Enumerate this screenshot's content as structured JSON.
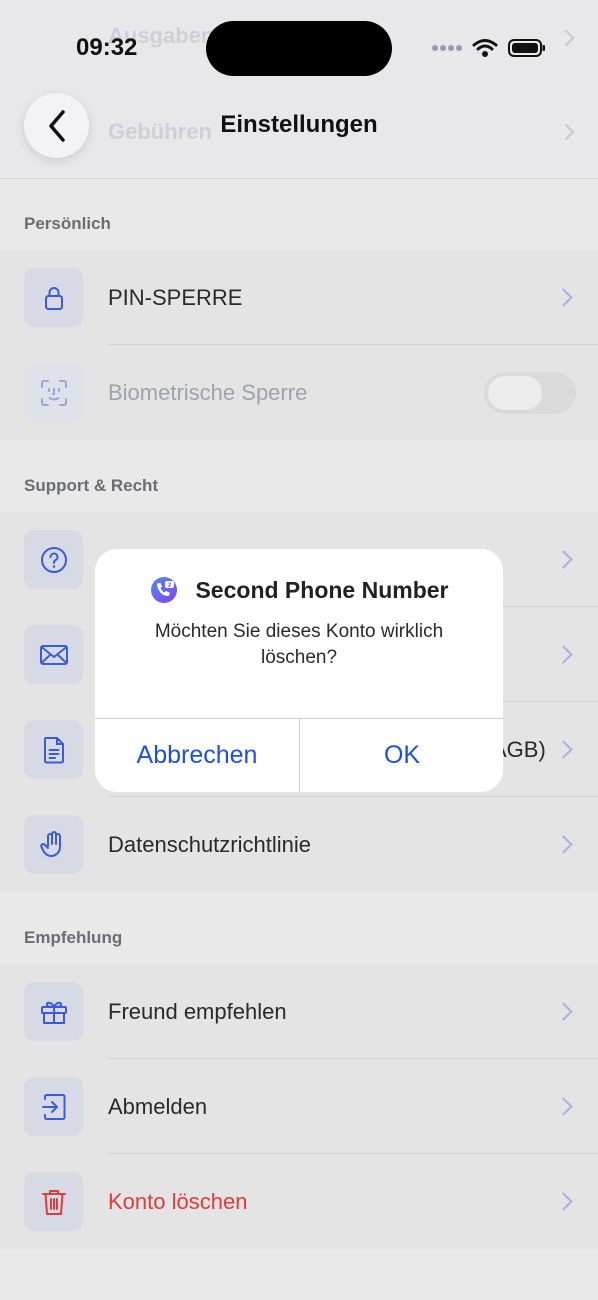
{
  "status_bar": {
    "time": "09:32"
  },
  "header": {
    "title": "Einstellungen",
    "back_icon": "chevron-left-icon",
    "background_ghost": [
      "Ausgaben",
      "Gebühren"
    ]
  },
  "sections": {
    "personal": {
      "label": "Persönlich",
      "items": [
        {
          "label": "PIN-SPERRE",
          "icon": "lock-icon"
        },
        {
          "label": "Biometrische Sperre",
          "icon": "face-id-icon",
          "toggle": false,
          "disabled": true
        }
      ]
    },
    "support": {
      "label": "Support & Recht",
      "items": [
        {
          "label": "",
          "icon": "help-circle-icon"
        },
        {
          "label": "",
          "icon": "mail-icon"
        },
        {
          "label": "AGB)",
          "icon": "document-icon"
        },
        {
          "label": "Datenschutzrichtlinie",
          "icon": "hand-icon"
        }
      ]
    },
    "referral": {
      "label": "Empfehlung",
      "items": [
        {
          "label": "Freund empfehlen",
          "icon": "gift-icon"
        },
        {
          "label": "Abmelden",
          "icon": "logout-icon"
        },
        {
          "label": "Konto löschen",
          "icon": "trash-icon",
          "danger": true
        }
      ]
    }
  },
  "dialog": {
    "app_icon": "second-phone-number-app-icon",
    "title": "Second Phone Number",
    "message": "Möchten Sie dieses Konto wirklich löschen?",
    "cancel": "Abbrechen",
    "ok": "OK"
  },
  "colors": {
    "accent": "#1d4fe0",
    "danger": "#e03c3c",
    "icon_blue": "#3c5bd8"
  }
}
